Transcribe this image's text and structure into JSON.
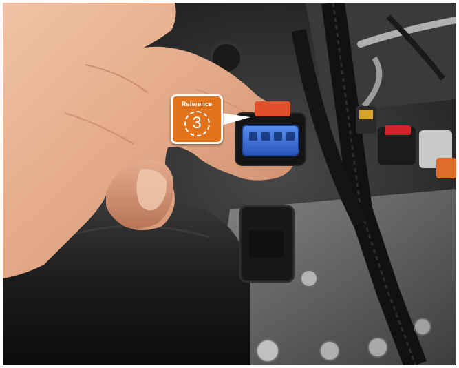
{
  "callout": {
    "label": "Reference",
    "number": "3"
  },
  "colors": {
    "callout_fill": "#e1731d",
    "callout_border": "#ffffff",
    "connector_body": "#3a6fd8",
    "connector_lock": "#e0502a"
  },
  "icons": {
    "callout": "numbered-reference-badge"
  }
}
